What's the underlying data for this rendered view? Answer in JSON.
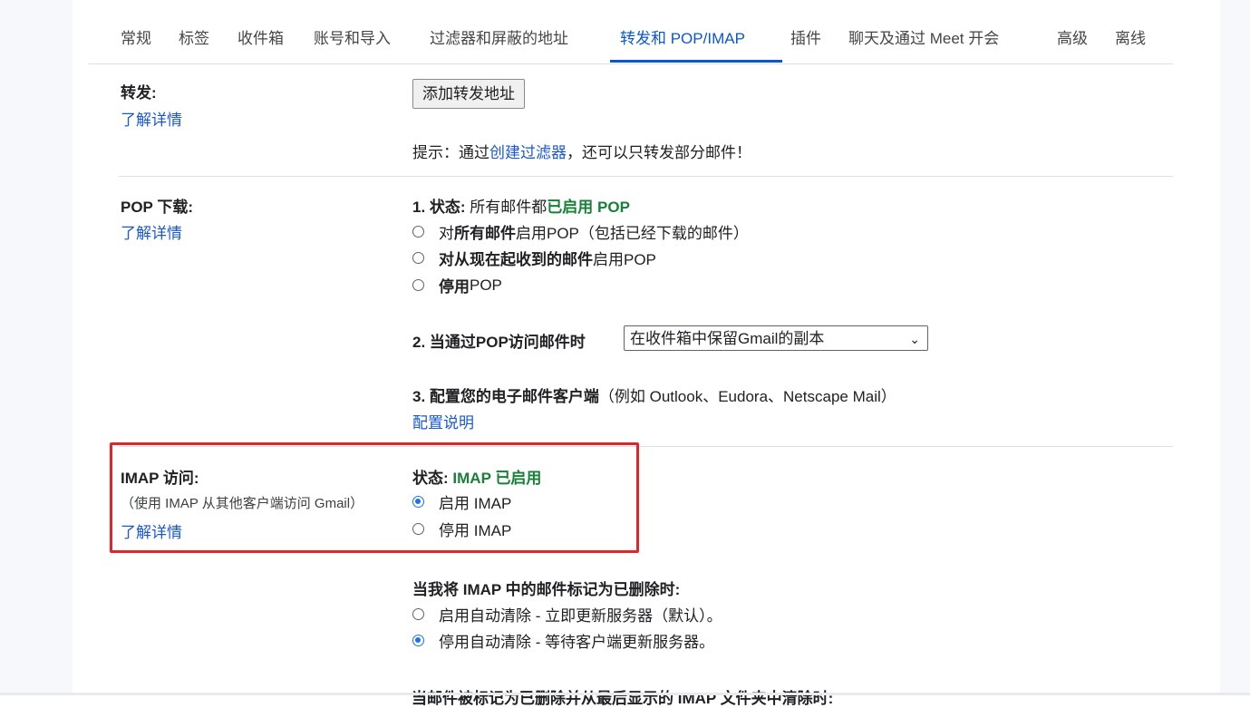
{
  "tabs": [
    {
      "label": "常规"
    },
    {
      "label": "标签"
    },
    {
      "label": "收件箱"
    },
    {
      "label": "账号和导入"
    },
    {
      "label": "过滤器和屏蔽的地址"
    },
    {
      "label": "转发和 POP/IMAP",
      "active": true
    },
    {
      "label": "插件"
    },
    {
      "label": "聊天及通过 Meet 开会"
    },
    {
      "label": "高级"
    },
    {
      "label": "离线"
    }
  ],
  "forwarding": {
    "label": "转发:",
    "learn_more": "了解详情",
    "add_button": "添加转发地址",
    "tip_prefix": "提示：通过",
    "tip_link": "创建过滤器",
    "tip_suffix": "，还可以只转发部分邮件！"
  },
  "pop": {
    "label": "POP 下载:",
    "learn_more": "了解详情",
    "status_prefix": "1. 状态:",
    "status_text": "所有邮件都",
    "status_value": "已启用 POP",
    "options": [
      {
        "prefix": "对",
        "bold": "所有邮件",
        "suffix": "启用POP（包括已经下载的邮件）",
        "checked": false
      },
      {
        "prefix": "",
        "bold": "对从现在起收到的邮件",
        "suffix": "启用POP",
        "checked": false
      },
      {
        "prefix": "",
        "bold": "停用",
        "suffix": "POP",
        "checked": false
      }
    ],
    "access_label": "2. 当通过POP访问邮件时",
    "access_selected": "在收件箱中保留Gmail的副本",
    "client_label": "3. 配置您的电子邮件客户端",
    "client_hint": "（例如 Outlook、Eudora、Netscape Mail）",
    "client_link": "配置说明"
  },
  "imap": {
    "label": "IMAP 访问:",
    "sublabel": "（使用 IMAP 从其他客户端访问 Gmail）",
    "learn_more": "了解详情",
    "status_prefix": "状态:",
    "status_value": "IMAP 已启用",
    "options": [
      {
        "label": "启用 IMAP",
        "checked": true
      },
      {
        "label": "停用 IMAP",
        "checked": false
      }
    ],
    "delete_heading": "当我将 IMAP 中的邮件标记为已删除时:",
    "delete_options": [
      {
        "label": "启用自动清除 - 立即更新服务器（默认）。",
        "checked": false
      },
      {
        "label": "停用自动清除 - 等待客户端更新服务器。",
        "checked": true
      }
    ],
    "expunge_heading": "当邮件被标记为已删除并从最后显示的 IMAP 文件夹中清除时:"
  },
  "colors": {
    "accent": "#0b57d0",
    "link": "#1a57d2",
    "enabled_green": "#188038",
    "highlight_red": "#e3242b"
  }
}
